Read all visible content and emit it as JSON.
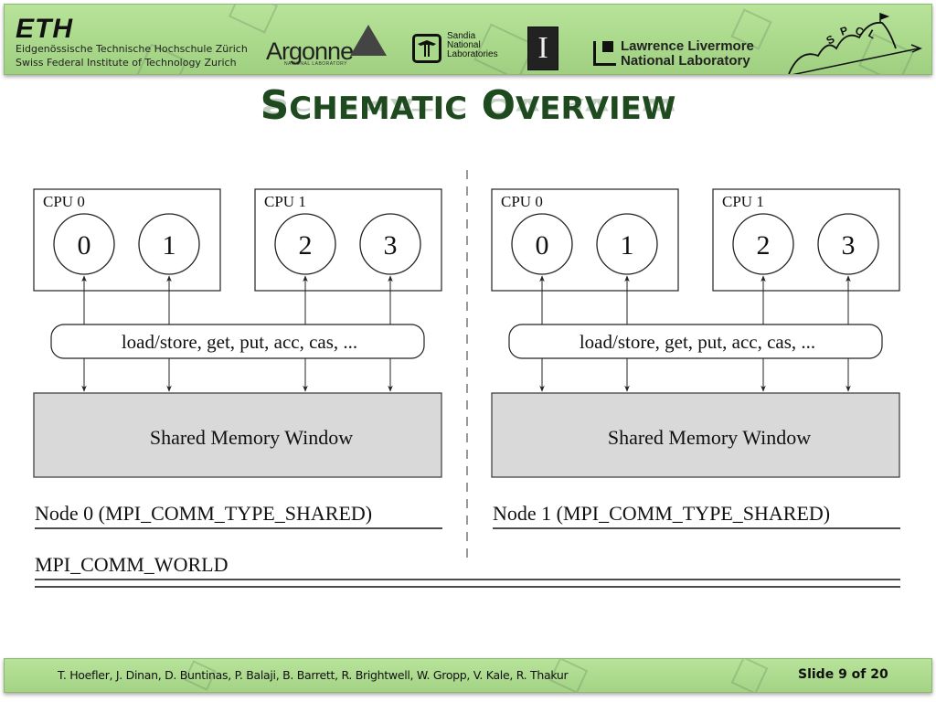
{
  "banner": {
    "eth": {
      "logo": "ETH",
      "line1": "Eidgenössische Technische Hochschule Zürich",
      "line2": "Swiss Federal Institute of Technology Zurich"
    },
    "argonne": {
      "name": "Argonne",
      "sub": "NATIONAL LABORATORY"
    },
    "sandia": {
      "glyph": "⚡",
      "lines": [
        "Sandia",
        "National",
        "Laboratories"
      ]
    },
    "illinois": {
      "glyph": "I"
    },
    "llnl": {
      "line1": "Lawrence Livermore",
      "line2": "National Laboratory"
    },
    "spcl": {
      "letters": "SPCL"
    }
  },
  "title": {
    "first_cap": "S",
    "first_rest": "CHEMATIC",
    "second_cap": "O",
    "second_rest": "VERVIEW"
  },
  "diagram": {
    "nodes": [
      {
        "cpus": [
          {
            "label": "CPU 0",
            "ranks": [
              "0",
              "1"
            ]
          },
          {
            "label": "CPU 1",
            "ranks": [
              "2",
              "3"
            ]
          }
        ],
        "ops_label": "load/store, get, put, acc, cas, ...",
        "window_label": "Shared Memory Window",
        "comm_label": "Node 0 (MPI_COMM_TYPE_SHARED)"
      },
      {
        "cpus": [
          {
            "label": "CPU 0",
            "ranks": [
              "0",
              "1"
            ]
          },
          {
            "label": "CPU 1",
            "ranks": [
              "2",
              "3"
            ]
          }
        ],
        "ops_label": "load/store, get, put, acc, cas, ...",
        "window_label": "Shared Memory Window",
        "comm_label": "Node 1 (MPI_COMM_TYPE_SHARED)"
      }
    ],
    "world_label": "MPI_COMM_WORLD",
    "colors": {
      "window_fill": "#d9d9d9",
      "stroke": "#222222"
    }
  },
  "footer": {
    "authors": "T. Hoefler, J. Dinan, D. Buntinas, P. Balaji, B. Barrett, R. Brightwell, W. Gropp, V. Kale, R. Thakur",
    "slide": "Slide 9 of 20"
  }
}
